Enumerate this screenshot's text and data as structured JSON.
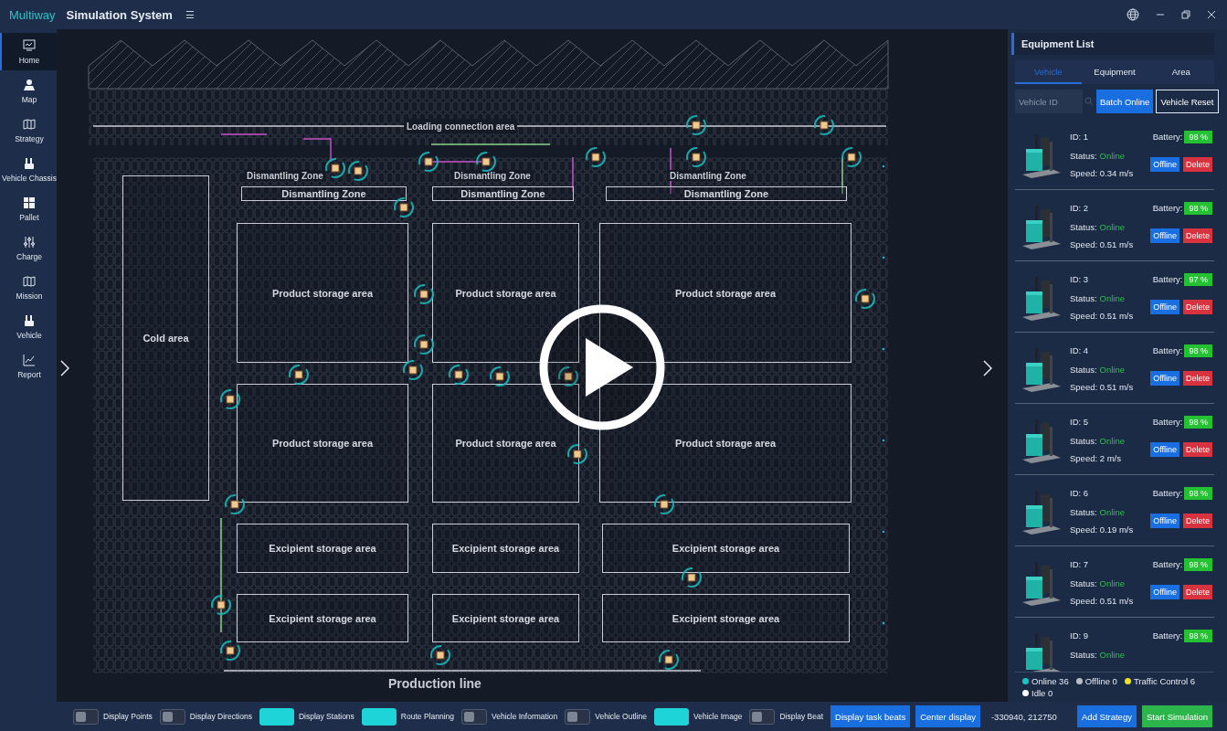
{
  "window": {
    "brand": "Multiway",
    "title": "Simulation System",
    "menu_glyph": "☰"
  },
  "sidebar": {
    "items": [
      {
        "label": "Home",
        "selected": true
      },
      {
        "label": "Map",
        "selected": false
      },
      {
        "label": "Strategy",
        "selected": false
      },
      {
        "label": "Vehicle Chassis",
        "selected": false
      },
      {
        "label": "Pallet",
        "selected": false
      },
      {
        "label": "Charge",
        "selected": false
      },
      {
        "label": "Mission",
        "selected": false
      },
      {
        "label": "Vehicle",
        "selected": false
      },
      {
        "label": "Report",
        "selected": false
      }
    ]
  },
  "map": {
    "zones": [
      {
        "kind": "caption",
        "label": "Loading connection area"
      },
      {
        "kind": "caption",
        "label": "Dismantling Zone"
      },
      {
        "kind": "caption",
        "label": "Dismantling Zone"
      },
      {
        "kind": "caption",
        "label": "Dismantling Zone"
      },
      {
        "kind": "area",
        "label": "Dismantling Zone"
      },
      {
        "kind": "area",
        "label": "Dismantling Zone"
      },
      {
        "kind": "area",
        "label": "Dismantling Zone"
      },
      {
        "kind": "area",
        "label": "Cold  area"
      },
      {
        "kind": "area",
        "label": "Product storage area"
      },
      {
        "kind": "area",
        "label": "Product storage area"
      },
      {
        "kind": "area",
        "label": "Product storage area"
      },
      {
        "kind": "area",
        "label": "Product storage area"
      },
      {
        "kind": "area",
        "label": "Product storage area"
      },
      {
        "kind": "area",
        "label": "Product storage area"
      },
      {
        "kind": "area",
        "label": "Excipient storage area"
      },
      {
        "kind": "area",
        "label": "Excipient storage area"
      },
      {
        "kind": "area",
        "label": "Excipient storage area"
      },
      {
        "kind": "area",
        "label": "Excipient storage area"
      },
      {
        "kind": "area",
        "label": "Excipient storage area"
      },
      {
        "kind": "area",
        "label": "Excipient storage area"
      },
      {
        "kind": "title",
        "label": "Production line"
      }
    ]
  },
  "equipment_panel": {
    "title": "Equipment List",
    "tabs": [
      {
        "label": "Vehicle",
        "selected": true
      },
      {
        "label": "Equipment",
        "selected": false
      },
      {
        "label": "Area",
        "selected": false
      }
    ],
    "search": {
      "placeholder": "Vehicle ID"
    },
    "buttons": [
      "Batch Online",
      "Vehicle Reset"
    ],
    "vehicles": [
      {
        "id": "ID: 1",
        "battery_label": "Battery:",
        "battery": "98 %",
        "status_label": "Status:",
        "status": "Online",
        "speed": "Speed: 0.34 m/s",
        "actions": [
          "Offline",
          "Delete"
        ]
      },
      {
        "id": "ID: 2",
        "battery_label": "Battery:",
        "battery": "98 %",
        "status_label": "Status:",
        "status": "Online",
        "speed": "Speed: 0.51 m/s",
        "actions": [
          "Offline",
          "Delete"
        ]
      },
      {
        "id": "ID: 3",
        "battery_label": "Battery:",
        "battery": "97 %",
        "status_label": "Status:",
        "status": "Online",
        "speed": "Speed: 0.51 m/s",
        "actions": [
          "Offline",
          "Delete"
        ]
      },
      {
        "id": "ID: 4",
        "battery_label": "Battery:",
        "battery": "98 %",
        "status_label": "Status:",
        "status": "Online",
        "speed": "Speed: 0.51 m/s",
        "actions": [
          "Offline",
          "Delete"
        ]
      },
      {
        "id": "ID: 5",
        "battery_label": "Battery:",
        "battery": "98 %",
        "status_label": "Status:",
        "status": "Online",
        "speed": "Speed: 2 m/s",
        "actions": [
          "Offline",
          "Delete"
        ]
      },
      {
        "id": "ID: 6",
        "battery_label": "Battery:",
        "battery": "98 %",
        "status_label": "Status:",
        "status": "Online",
        "speed": "Speed: 0.19 m/s",
        "actions": [
          "Offline",
          "Delete"
        ]
      },
      {
        "id": "ID: 7",
        "battery_label": "Battery:",
        "battery": "98 %",
        "status_label": "Status:",
        "status": "Online",
        "speed": "Speed: 0.51 m/s",
        "actions": [
          "Offline",
          "Delete"
        ]
      },
      {
        "id": "ID: 9",
        "battery_label": "Battery:",
        "battery": "98 %",
        "status_label": "Status:",
        "status": "Online"
      }
    ],
    "legend": [
      {
        "label": "Online 36",
        "color": "#17c6c9"
      },
      {
        "label": "Offline 0",
        "color": "#b8bec8"
      },
      {
        "label": "Traffic Control 6",
        "color": "#f2e21a"
      },
      {
        "label": "Idle 0",
        "color": "#ffffff"
      }
    ]
  },
  "bottom_bar": {
    "toggles": [
      {
        "label": "Display Points",
        "on": false
      },
      {
        "label": "Display Directions",
        "on": false
      },
      {
        "label": "Display Stations",
        "on": true
      },
      {
        "label": "Route Planning",
        "on": true
      },
      {
        "label": "Vehicle Information",
        "on": false
      },
      {
        "label": "Vehicle Outline",
        "on": false
      },
      {
        "label": "Vehicle Image",
        "on": true
      },
      {
        "label": "Display Beat",
        "on": false
      }
    ],
    "buttons": [
      "Display task beats",
      "Center display"
    ],
    "coordinates": "-330940, 212750",
    "actions": [
      {
        "label": "Add Strategy",
        "kind": "primary"
      },
      {
        "label": "Start Simulation",
        "kind": "success"
      }
    ]
  }
}
